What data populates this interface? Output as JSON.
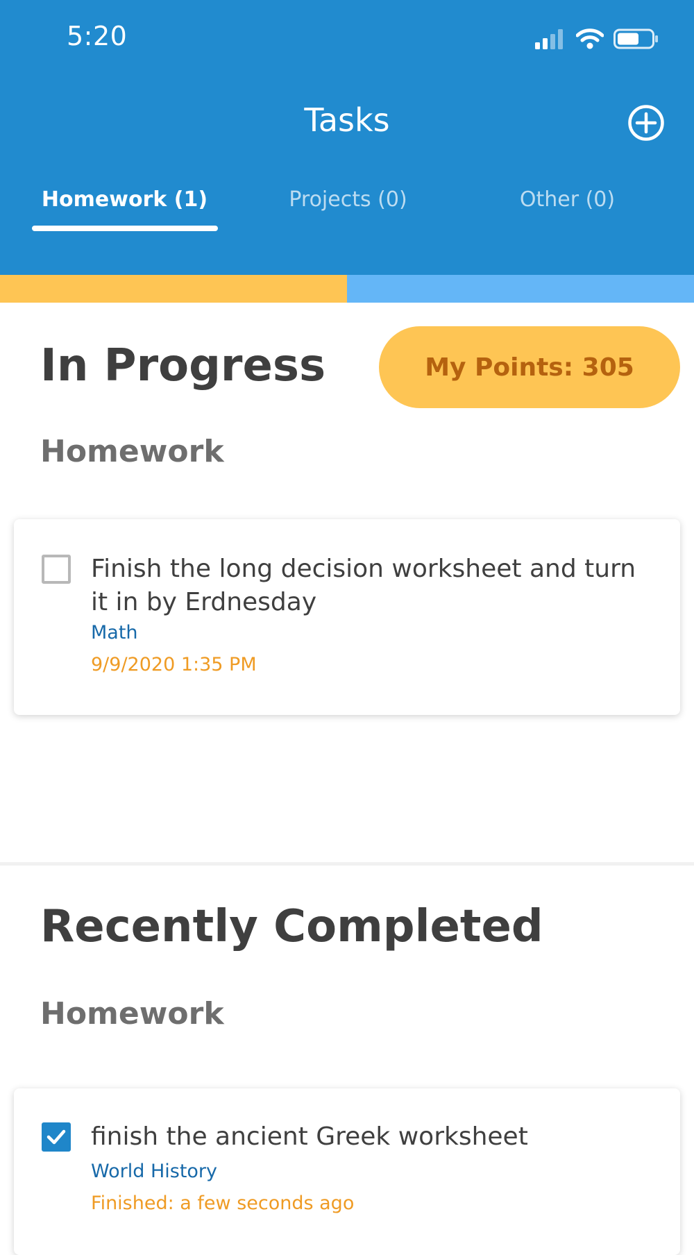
{
  "status_bar": {
    "time": "5:20"
  },
  "header": {
    "title": "Tasks"
  },
  "tabs": [
    {
      "label": "Homework (1)",
      "active": true
    },
    {
      "label": "Projects (0)",
      "active": false
    },
    {
      "label": "Other (0)",
      "active": false
    }
  ],
  "progress": {
    "fraction": 0.5,
    "fill_color": "#fec554",
    "track_color": "#64b6f7"
  },
  "in_progress": {
    "title": "In Progress",
    "points_label": "My Points: 305",
    "group_title": "Homework",
    "task": {
      "text": "Finish the long decision worksheet and turn it in by Erdnesday",
      "subject": "Math",
      "date": "9/9/2020 1:35 PM",
      "checked": false
    }
  },
  "recently_completed": {
    "title": "Recently Completed",
    "group_title": "Homework",
    "task": {
      "text": "finish the ancient Greek worksheet",
      "subject": "World History",
      "finished": "Finished: a few seconds ago",
      "checked": true
    }
  },
  "colors": {
    "header_blue": "#218bcf",
    "accent_yellow": "#fec554",
    "subject_blue": "#1769a9",
    "date_orange": "#ef9b24"
  }
}
